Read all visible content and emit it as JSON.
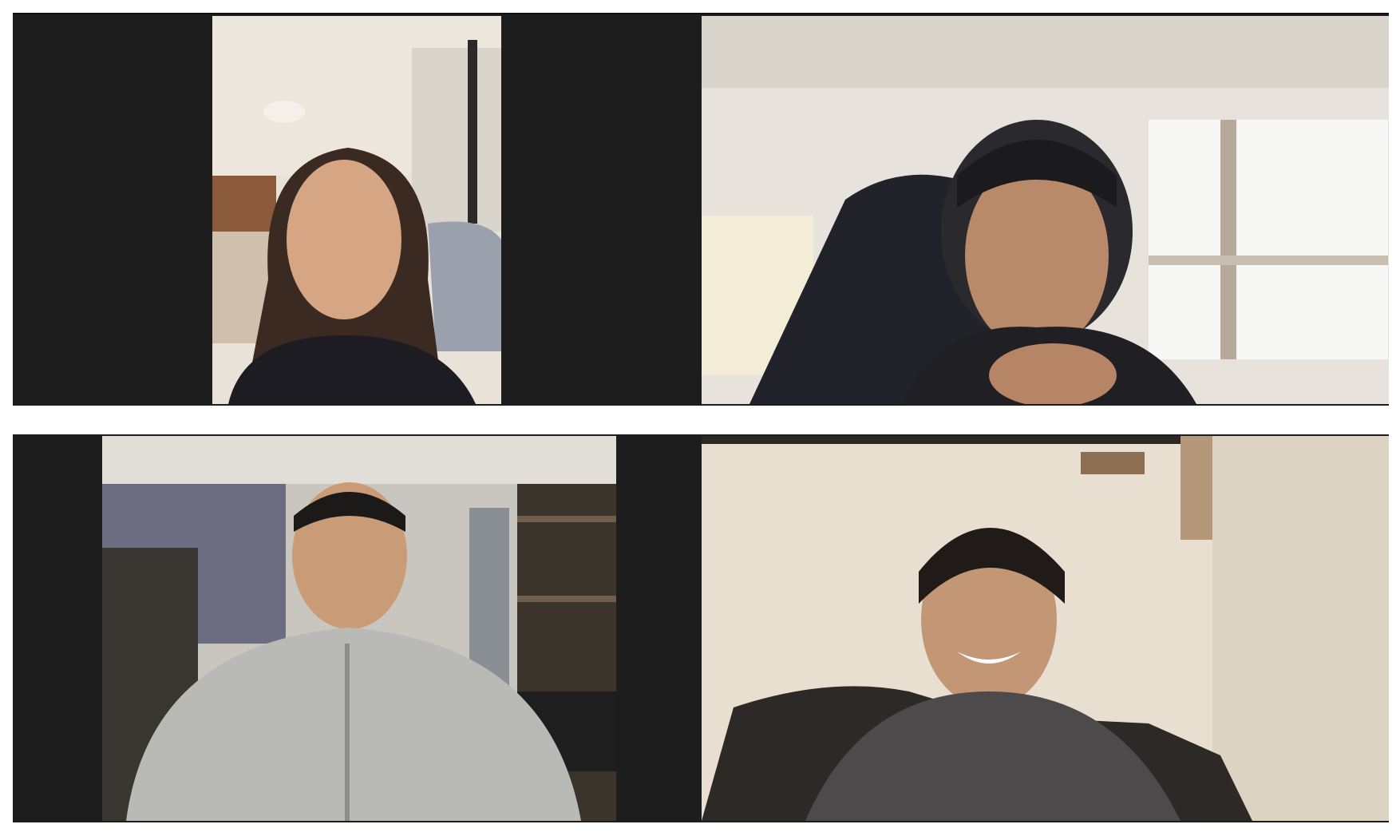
{
  "meeting": {
    "layout": "gallery-2x2",
    "participant_count": 4
  },
  "participants": [
    {
      "tile": "top-left",
      "video_icon": "person-video-icon"
    },
    {
      "tile": "top-right",
      "video_icon": "person-video-icon"
    },
    {
      "tile": "bottom-left",
      "video_icon": "person-video-icon"
    },
    {
      "tile": "bottom-right",
      "video_icon": "person-video-icon"
    }
  ],
  "colors": {
    "tile_background": "#1d1d1d",
    "page_background": "#ffffff"
  }
}
